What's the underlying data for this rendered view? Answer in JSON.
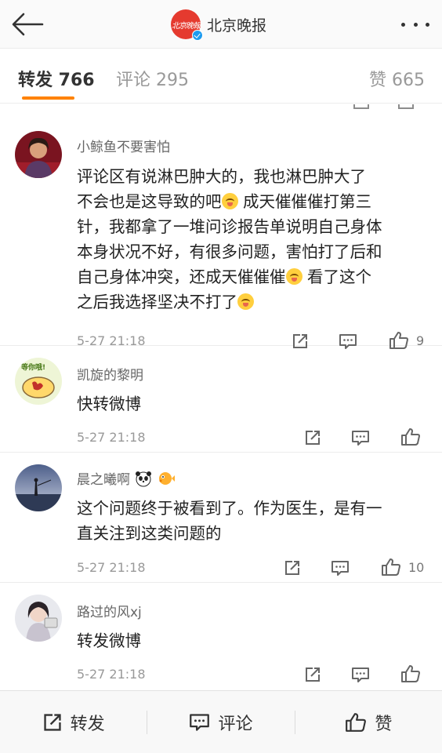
{
  "header": {
    "account_name": "北京晚报",
    "logo_text": "北京晚報"
  },
  "tabs": {
    "forward": "转发 766",
    "comment": "评论 295",
    "like": "赞 665"
  },
  "comments": [
    {
      "name": "小鲸鱼不要害怕",
      "lines": [
        "评论区有说淋巴肿大的，我也淋巴肿大了",
        "不会也是这导致的吧",
        " 成天催催催打第三",
        "针，我都拿了一堆问诊报告单说明自己身体",
        "本身状况不好，有很多问题，害怕打了后和",
        "自己身体冲突，还成天催催催",
        " 看了这个",
        "之后我选择坚决不打了"
      ],
      "time": "5-27 21:18",
      "likes": "9"
    },
    {
      "name": "凯旋的黎明",
      "avatar_text": "等你哦!",
      "lines": [
        "快转微博"
      ],
      "time": "5-27 21:18",
      "likes": ""
    },
    {
      "name": "晨之曦啊",
      "lines": [
        "这个问题终于被看到了。作为医生，是有一",
        "直关注到这类问题的"
      ],
      "time": "5-27 21:18",
      "likes": "10"
    },
    {
      "name": "路过的风xj",
      "lines": [
        "转发微博"
      ],
      "time": "5-27 21:18",
      "likes": ""
    }
  ],
  "bottombar": {
    "forward": "转发",
    "comment": "评论",
    "like": "赞"
  },
  "colors": {
    "accent": "#ff8200",
    "verify": "#1d9bf0",
    "logo": "#e53a2f"
  }
}
